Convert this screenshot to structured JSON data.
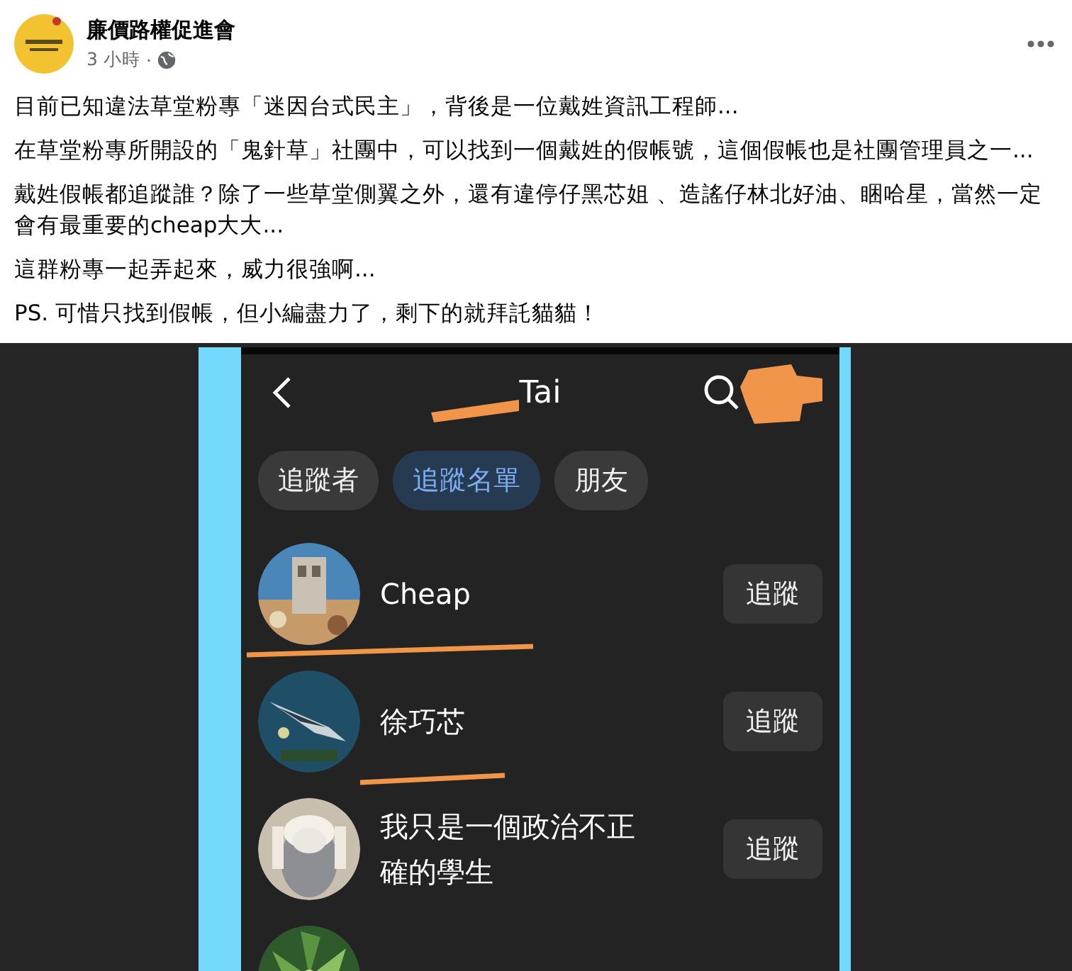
{
  "post": {
    "author": "廉價路權促進會",
    "time": "3 小時",
    "separator": "·",
    "paragraphs": [
      "目前已知違法草堂粉專「迷因台式民主」，背後是一位戴姓資訊工程師...",
      "在草堂粉專所開設的「鬼針草」社團中，可以找到一個戴姓的假帳號，這個假帳也是社團管理員之一...",
      "戴姓假帳都追蹤誰？除了一些草堂側翼之外，還有違停仔黑芯姐 、造謠仔林北好油、睏哈星，當然一定會有最重要的cheap大大...",
      "這群粉專一起弄起來，威力很強啊...",
      "PS. 可惜只找到假帳，但小編盡力了，剩下的就拜託貓貓！"
    ]
  },
  "screenshot": {
    "title": "Tai",
    "tabs": [
      {
        "label": "追蹤者",
        "selected": false
      },
      {
        "label": "追蹤名單",
        "selected": true
      },
      {
        "label": "朋友",
        "selected": false
      }
    ],
    "rows": [
      {
        "kind": "full",
        "name": "Cheap",
        "button": "追蹤",
        "underlined": true
      },
      {
        "kind": "full",
        "name": "徐巧芯",
        "button": "追蹤",
        "underlined": true
      },
      {
        "kind": "full",
        "name": "我只是一個政治不正確的學生",
        "button": "追蹤",
        "underlined": false
      },
      {
        "kind": "partial"
      }
    ]
  }
}
